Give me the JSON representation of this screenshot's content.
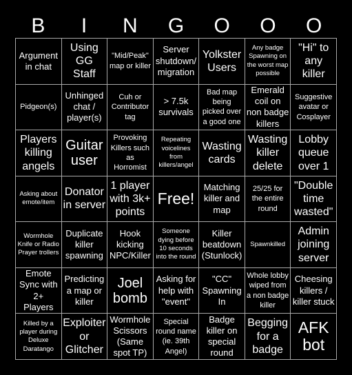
{
  "header": {
    "letters": [
      "B",
      "I",
      "N",
      "G",
      "O",
      "O",
      "O"
    ]
  },
  "board": {
    "cells": [
      [
        "Argument in chat",
        "Using GG Staff",
        "\"Mid/Peak\" map or killer",
        "Server shutdown/ migration",
        "Yolkster Users",
        "Any badge Spawning on the worst map possible",
        "\"Hi\" to any killer"
      ],
      [
        "Pidgeon(s)",
        "Unhinged chat / player(s)",
        "Cuh or Contributor tag",
        "> 7.5k survivals",
        "Bad map being picked over a good one",
        "Emerald coil on non badge killers",
        "Suggestive avatar or Cosplayer"
      ],
      [
        "Players killing angels",
        "Guitar user",
        "Provoking Killers such as Horromist",
        "Repeating voicelines from killers/angel",
        "Wasting cards",
        "Wasting killer delete",
        "Lobby queue over 1"
      ],
      [
        "Asking about emote/item",
        "Donator in server",
        "1 player with 3k+ points",
        "Free!",
        "Matching killer and map",
        "25/25 for the entire round",
        "\"Double time wasted\""
      ],
      [
        "Wormhole Knife or Radio Prayer trollers",
        "Duplicate killer spawning",
        "Hook kicking NPC/Killer",
        "Someone dying before 10 seconds into the round",
        "Killer beatdown (Stunlock)",
        "Spawnkilled",
        "Admin joining server"
      ],
      [
        "Emote Sync with 2+ Players",
        "Predicting a map or killer",
        "Joel bomb",
        "Asking for help with \"event\"",
        "\"CC\" Spawning In",
        "Whole lobby wiped from a non badge killer",
        "Cheesing killers / killer stuck"
      ],
      [
        "Killed by a player during Deluxe Daratango",
        "Exploiter or Glitcher",
        "Wormhole Scissors (Same spot TP)",
        "Special round name (ie. 39th Angel)",
        "Badge killer on special round",
        "Begging for a badge",
        "AFK bot"
      ]
    ]
  },
  "colors": {
    "background": "#000000",
    "text": "#ffffff",
    "grid_lines": "#aaaaaa"
  }
}
